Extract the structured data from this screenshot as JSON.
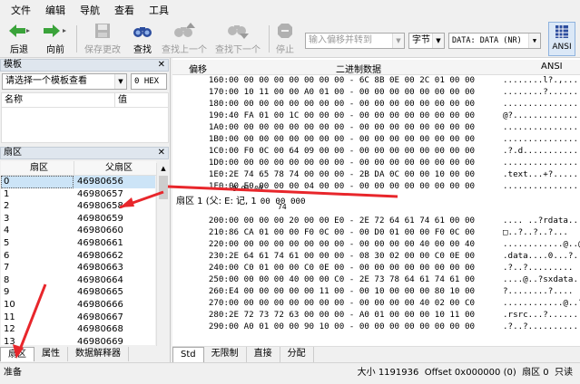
{
  "menu": [
    "文件",
    "编辑",
    "导航",
    "查看",
    "工具"
  ],
  "toolbar": {
    "back": "后退",
    "forward": "向前",
    "save": "保存更改",
    "find": "查找",
    "find_prev": "查找上一个",
    "find_next": "查找下一个",
    "stop": "停止",
    "offset_placeholder": "输入偏移并转到",
    "unit": "字节",
    "data_source": "DATA: DATA (NR)",
    "ansi": "ANSI"
  },
  "template_panel": {
    "title": "模板",
    "selector": "请选择一个模板查看",
    "format": "0 HEX",
    "col_name": "名称",
    "col_value": "值"
  },
  "sector_panel": {
    "title": "扇区",
    "col_sector": "扇区",
    "col_parent": "父扇区",
    "rows": [
      [
        "0",
        "46980656"
      ],
      [
        "1",
        "46980657"
      ],
      [
        "2",
        "46980658"
      ],
      [
        "3",
        "46980659"
      ],
      [
        "4",
        "46980660"
      ],
      [
        "5",
        "46980661"
      ],
      [
        "6",
        "46980662"
      ],
      [
        "7",
        "46980663"
      ],
      [
        "8",
        "46980664"
      ],
      [
        "9",
        "46980665"
      ],
      [
        "10",
        "46980666"
      ],
      [
        "11",
        "46980667"
      ],
      [
        "12",
        "46980668"
      ],
      [
        "13",
        "46980669"
      ]
    ]
  },
  "left_tabs": [
    "扇区",
    "属性",
    "数据解释器"
  ],
  "hex": {
    "col_offset": "偏移",
    "col_hex": "二进制数据",
    "col_ansi": "ANSI",
    "lines_top": [
      [
        "160:",
        "00 00 00 00 00 00 00 00 - 6C 8B 0E 00 2C 01 00 00",
        "........l?.,..."
      ],
      [
        "170:",
        "00 10 11 00 00 A0 01 00 - 00 00 00 00 00 00 00 00",
        "........?......"
      ],
      [
        "180:",
        "00 00 00 00 00 00 00 00 - 00 00 00 00 00 00 00 00",
        "..............."
      ],
      [
        "190:",
        "40 FA 01 00 1C 00 00 00 - 00 00 00 00 00 00 00 00",
        "@?............."
      ],
      [
        "1A0:",
        "00 00 00 00 00 00 00 00 - 00 00 00 00 00 00 00 00",
        "..............."
      ],
      [
        "1B0:",
        "00 00 00 00 00 00 00 00 - 00 00 00 00 00 00 00 00",
        "..............."
      ],
      [
        "1C0:",
        "00 F0 0C 00 64 09 00 00 - 00 00 00 00 00 00 00 00",
        ".?.d..........."
      ],
      [
        "1D0:",
        "00 00 00 00 00 00 00 00 - 00 00 00 00 00 00 00 00",
        "..............."
      ],
      [
        "1E0:",
        "2E 74 65 78 74 00 00 00 - 2B DA 0C 00 00 10 00 00",
        ".text...+?....."
      ],
      [
        "1F0:",
        "00 E0 00 00 00 04 00 00 - 00 00 00 00 00 00 00 00",
        "..............."
      ]
    ],
    "overlay_a": "8 01 00",
    "sector_label": "扇区 1 (父: E: 记, 1",
    "sector_bytes": "00 00 000",
    "overlay_b": "74",
    "lines_bottom": [
      [
        "200:",
        "00 00 00 00 20 00 00 E0 - 2E 72 64 61 74 61 00 00",
        ".... ..?rdata.."
      ],
      [
        "210:",
        "86 CA 01 00 00 F0 0C 00 - 00 D0 01 00 00 F0 0C 00",
        "□..?..?..?..."
      ],
      [
        "220:",
        "00 00 00 00 00 00 00 00 - 00 00 00 00 40 00 00 40",
        "............@..@"
      ],
      [
        "230:",
        "2E 64 61 74 61 00 00 00 - 08 30 02 00 00 C0 0E 00",
        ".data....0...?.."
      ],
      [
        "240:",
        "00 C0 01 00 00 C0 0E 00 - 00 00 00 00 00 00 00 00",
        ".?..?........."
      ],
      [
        "250:",
        "00 00 00 00 40 00 00 C0 - 2E 73 78 64 61 74 61 00",
        "....@..?sxdata."
      ],
      [
        "260:",
        "E4 00 00 00 00 00 11 00 - 00 10 00 00 00 80 10 00",
        "?........?...."
      ],
      [
        "270:",
        "00 00 00 00 00 00 00 00 - 00 00 00 00 40 02 00 C0",
        "............@..?"
      ],
      [
        "280:",
        "2E 72 73 72 63 00 00 00 - A0 01 00 00 00 10 11 00",
        ".rsrc...?......."
      ],
      [
        "290:",
        "00 A0 01 00 00 90 10 00 - 00 00 00 00 00 00 00 00",
        ".?..?.........."
      ]
    ]
  },
  "hex_tabs": [
    "Std",
    "无限制",
    "直接",
    "分配"
  ],
  "status": {
    "left": "准备",
    "right": "大小 1191936  Offset 0x000000 (0)  扇区 0  只读"
  },
  "colors": {
    "arrow": "#e8262b",
    "selection": "#cce4f7",
    "header": "#dfe6ee"
  }
}
